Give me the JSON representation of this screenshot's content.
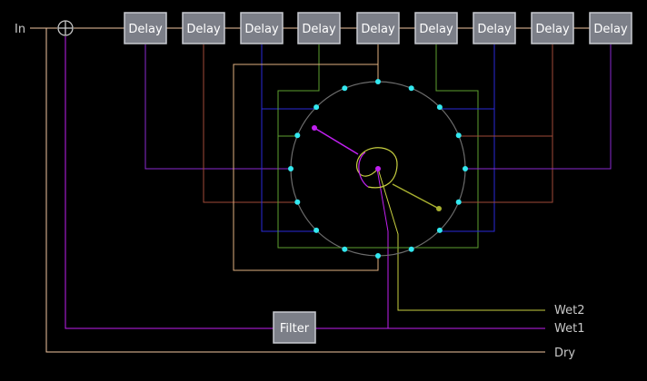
{
  "input_label": "In",
  "mixer_symbol": "⊕",
  "delay_label": "Delay",
  "delay_count": 9,
  "filter_label": "Filter",
  "outputs": {
    "wet2": "Wet2",
    "wet1": "Wet1",
    "dry": "Dry"
  },
  "colors": {
    "background": "#000000",
    "block_fill": "#7c7f88",
    "block_border": "#c8cad0",
    "dry": "#f2c6a0",
    "wet1": "#c020f0",
    "wet2": "#c8d040",
    "tap": "#33e8f0",
    "hub_ring": "#6c6c6c",
    "tap_blue": "#2a2ad8",
    "tap_green": "#5ea030",
    "tap_rust": "#a04a38",
    "tap_tan": "#e0b080",
    "tap_purple": "#8a2ad0"
  }
}
